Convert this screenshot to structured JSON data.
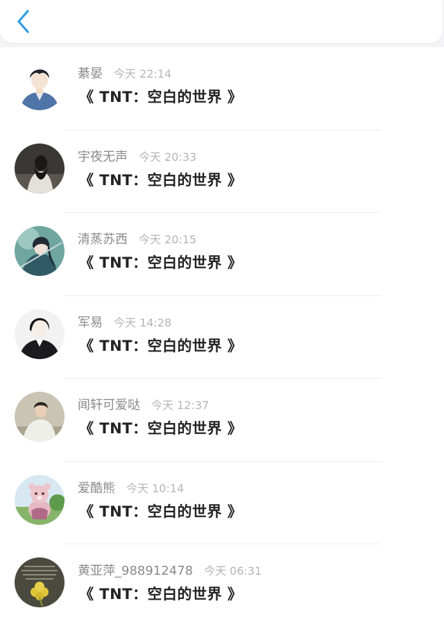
{
  "header": {
    "back_icon": "chevron-left-icon",
    "accent_color": "#2f9be6"
  },
  "messages": [
    {
      "name": "綦晏",
      "time": "今天 22:14",
      "text": "《 TNT：空白的世界 》",
      "avatar": "boy-illustration-avatar"
    },
    {
      "name": "宇夜无声",
      "time": "今天 20:33",
      "text": "《 TNT：空白的世界 》",
      "avatar": "dark-girl-photo-avatar"
    },
    {
      "name": "清蒸苏西",
      "time": "今天 20:15",
      "text": "《 TNT：空白的世界 》",
      "avatar": "anime-swordswoman-avatar"
    },
    {
      "name": "军易",
      "time": "今天 14:28",
      "text": "《 TNT：空白的世界 》",
      "avatar": "anime-man-avatar"
    },
    {
      "name": "闻轩可爱哒",
      "time": "今天 12:37",
      "text": "《 TNT：空白的世界 》",
      "avatar": "young-man-photo-avatar"
    },
    {
      "name": "爱酷熊",
      "time": "今天 10:14",
      "text": "《 TNT：空白的世界 》",
      "avatar": "plush-bear-avatar"
    },
    {
      "name": "黄亚萍_988912478",
      "time": "今天 06:31",
      "text": "《 TNT：空白的世界 》",
      "avatar": "clover-text-avatar"
    }
  ]
}
